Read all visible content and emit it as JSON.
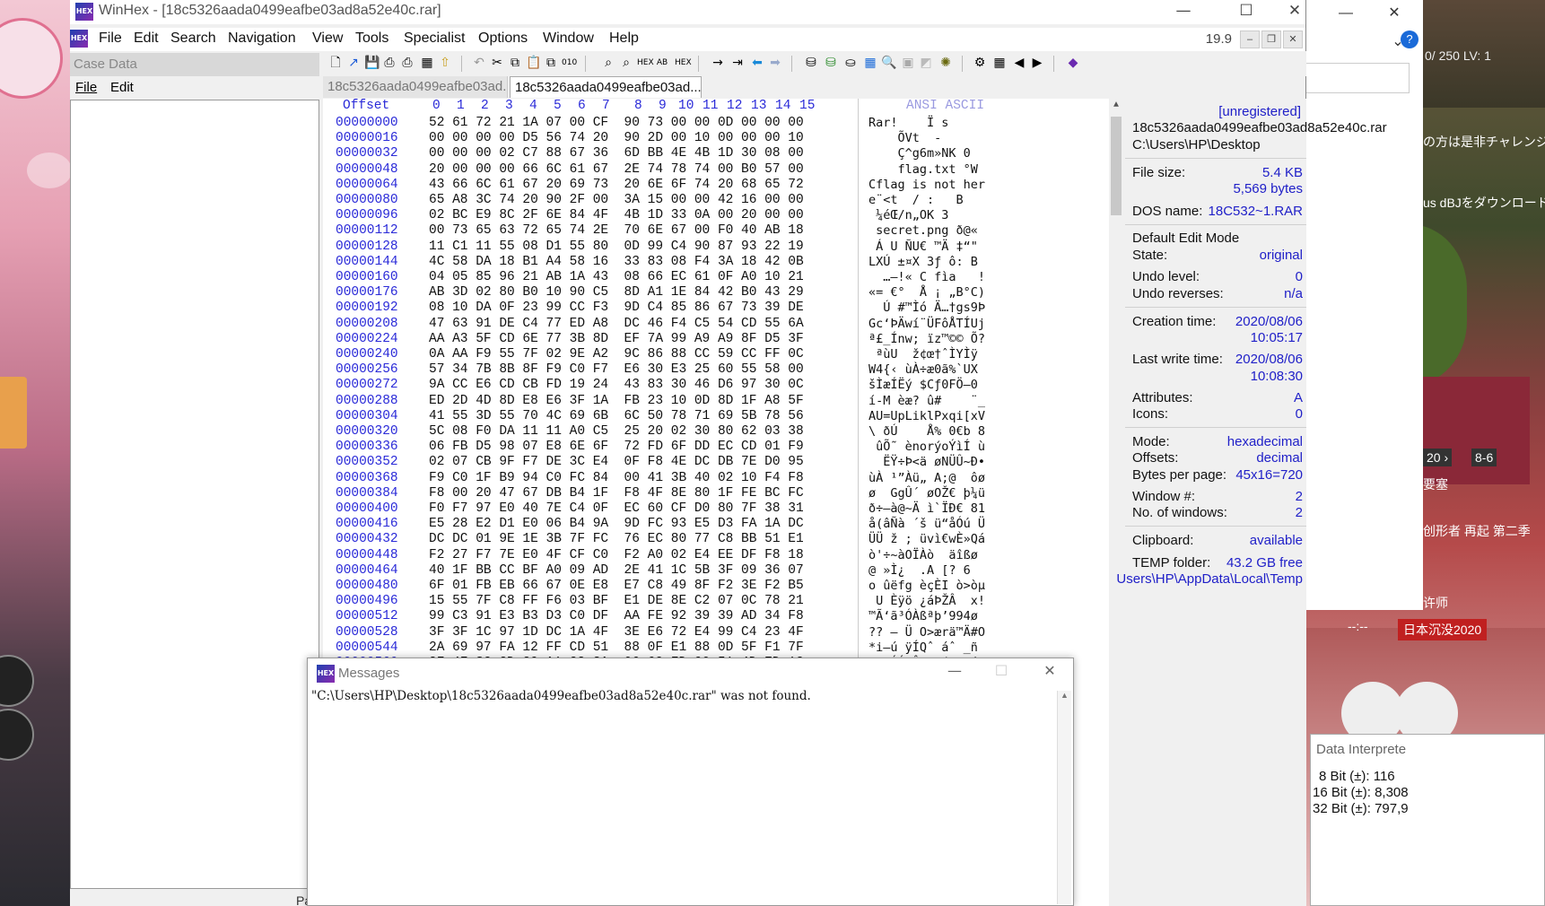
{
  "main_title": "WinHex - [18c5326aada0499eafbe03ad8a52e40c.rar]",
  "menu": [
    "File",
    "Edit",
    "Search",
    "Navigation",
    "View",
    "Tools",
    "Specialist",
    "Options",
    "Window",
    "Help"
  ],
  "version": "19.9",
  "case_panel": {
    "header": "Case Data",
    "menu_file": "File",
    "menu_edit": "Edit"
  },
  "tabs": [
    "18c5326aada0499eafbe03ad...",
    "18c5326aada0499eafbe03ad..."
  ],
  "hex_header": {
    "offset": "Offset",
    "cols": [
      "0",
      "1",
      "2",
      "3",
      "4",
      "5",
      "6",
      "7",
      "8",
      "9",
      "10",
      "11",
      "12",
      "13",
      "14",
      "15"
    ],
    "ansi": "ANSI ASCII"
  },
  "hex_rows": [
    {
      "off": "00000000",
      "bytes": "52 61 72 21 1A 07 00 CF  90 73 00 00 0D 00 00 00",
      "ascii": "Rar!    Ï s"
    },
    {
      "off": "00000016",
      "bytes": "00 00 00 00 D5 56 74 20  90 2D 00 10 00 00 00 10",
      "ascii": "    ÕVt  -"
    },
    {
      "off": "00000032",
      "bytes": "00 00 00 02 C7 88 67 36  6D BB 4E 4B 1D 30 08 00",
      "ascii": "    Ç^g6m»NK 0"
    },
    {
      "off": "00000048",
      "bytes": "20 00 00 00 66 6C 61 67  2E 74 78 74 00 B0 57 00",
      "ascii": "    flag.txt °W"
    },
    {
      "off": "00000064",
      "bytes": "43 66 6C 61 67 20 69 73  20 6E 6F 74 20 68 65 72",
      "ascii": "Cflag is not her"
    },
    {
      "off": "00000080",
      "bytes": "65 A8 3C 74 20 90 2F 00  3A 15 00 00 42 16 00 00",
      "ascii": "e¨<t  / :   B"
    },
    {
      "off": "00000096",
      "bytes": "02 BC E9 8C 2F 6E 84 4F  4B 1D 33 0A 00 20 00 00",
      "ascii": " ¼éŒ/n„OK 3"
    },
    {
      "off": "00000112",
      "bytes": "00 73 65 63 72 65 74 2E  70 6E 67 00 F0 40 AB 18",
      "ascii": " secret.png ð@«"
    },
    {
      "off": "00000128",
      "bytes": "11 C1 11 55 08 D1 55 80  0D 99 C4 90 87 93 22 19",
      "ascii": " Á U ÑU€ ™Ä ‡“\""
    },
    {
      "off": "00000144",
      "bytes": "4C 58 DA 18 B1 A4 58 16  33 83 08 F4 3A 18 42 0B",
      "ascii": "LXÚ ±¤X 3ƒ ô: B"
    },
    {
      "off": "00000160",
      "bytes": "04 05 85 96 21 AB 1A 43  08 66 EC 61 0F A0 10 21",
      "ascii": "  …–!« C fìa   !"
    },
    {
      "off": "00000176",
      "bytes": "AB 3D 02 80 B0 10 90 C5  8D A1 1E 84 42 B0 43 29",
      "ascii": "«= €°  Å ¡ „B°C)"
    },
    {
      "off": "00000192",
      "bytes": "08 10 DA 0F 23 99 CC F3  9D C4 85 86 67 73 39 DE",
      "ascii": "  Ú #™Ìó Ä…†gs9Þ"
    },
    {
      "off": "00000208",
      "bytes": "47 63 91 DE C4 77 ED A8  DC 46 F4 C5 54 CD 55 6A",
      "ascii": "Gc‘ÞÄwí¨ÜFôÅTÍUj"
    },
    {
      "off": "00000224",
      "bytes": "AA A3 5F CD 6E 77 3B 8D  EF 7A 99 A9 A9 8F D5 3F",
      "ascii": "ª£_Ínw; ïz™©© Õ?"
    },
    {
      "off": "00000240",
      "bytes": "0A AA F9 55 7F 02 9E A2  9C 86 88 CC 59 CC FF 0C",
      "ascii": " ªùU  ž¢œ†ˆÌYÌÿ"
    },
    {
      "off": "00000256",
      "bytes": "57 34 7B 8B 8F F9 C0 F7  E6 30 E3 25 60 55 58 00",
      "ascii": "W4{‹ ùÀ÷æ0ã%`UX"
    },
    {
      "off": "00000272",
      "bytes": "9A CC E6 CD CB FD 19 24  43 83 30 46 D6 97 30 0C",
      "ascii": "šÌæÍËý $Cƒ0FÖ—0"
    },
    {
      "off": "00000288",
      "bytes": "ED 2D 4D 8D E8 E6 3F 1A  FB 23 10 0D 8D 1F A8 5F",
      "ascii": "í-M èæ? û#    ¨_"
    },
    {
      "off": "00000304",
      "bytes": "41 55 3D 55 70 4C 69 6B  6C 50 78 71 69 5B 78 56",
      "ascii": "AU=UpLiklPxqi[xV"
    },
    {
      "off": "00000320",
      "bytes": "5C 08 F0 DA 11 11 A0 C5  25 20 02 30 80 62 03 38",
      "ascii": "\\ ðÚ    Å% 0€b 8"
    },
    {
      "off": "00000336",
      "bytes": "06 FB D5 98 07 E8 6E 6F  72 FD 6F DD EC CD 01 F9",
      "ascii": " ûÕ˜ ènorýoÝìÍ ù"
    },
    {
      "off": "00000352",
      "bytes": "02 07 CB 9F F7 DE 3C E4  0F F8 4E DC DB 7E D0 95",
      "ascii": "  ËŸ÷Þ<ä øNÜÛ~Ð•"
    },
    {
      "off": "00000368",
      "bytes": "F9 C0 1F B9 94 C0 FC 84  00 41 3B 40 02 10 F4 F8",
      "ascii": "ùÀ ¹”Àü„ A;@  ôø"
    },
    {
      "off": "00000384",
      "bytes": "F8 00 20 47 67 DB B4 1F  F8 4F 8E 80 1F FE BC FC",
      "ascii": "ø  GgÛ´ øOŽ€ þ¼ü"
    },
    {
      "off": "00000400",
      "bytes": "F0 F7 97 E0 40 7E C4 0F  EC 60 CF D0 80 7F 38 31",
      "ascii": "ð÷—à@~Ä ì`ÏÐ€ 81"
    },
    {
      "off": "00000416",
      "bytes": "E5 28 E2 D1 E0 06 B4 9A  9D FC 93 E5 D3 FA 1A DC",
      "ascii": "å(âÑà ´š ü“åÓú Ü"
    },
    {
      "off": "00000432",
      "bytes": "DC DC 01 9E 1E 3B 7F FC  76 EC 80 77 C8 BB 51 E1",
      "ascii": "ÜÜ ž ; üvì€wÈ»Qá"
    },
    {
      "off": "00000448",
      "bytes": "F2 27 F7 7E E0 4F CF C0  F2 A0 02 E4 EE DF F8 18",
      "ascii": "ò'÷~àOÏÀò  äîßø"
    },
    {
      "off": "00000464",
      "bytes": "40 1F BB CC BF A0 09 AD  2E 41 1C 5B 3F 09 36 07",
      "ascii": "@ »Ì¿  .A [? 6"
    },
    {
      "off": "00000480",
      "bytes": "6F 01 FB EB 66 67 0E E8  E7 C8 49 8F F2 3E F2 B5",
      "ascii": "o ûëfg èçÈI ò>òµ"
    },
    {
      "off": "00000496",
      "bytes": "15 55 7F C8 FF F6 03 BF  E1 DE 8E C2 07 0C 78 21",
      "ascii": " U Èÿö ¿áÞŽÂ  x!"
    },
    {
      "off": "00000512",
      "bytes": "99 C3 91 E3 B3 D3 C0 DF  AA FE 92 39 39 AD 34 F8",
      "ascii": "™Ã‘ã³ÓÀßªþ’99­4ø"
    },
    {
      "off": "00000528",
      "bytes": "3F 3F 1C 97 1D DC 1A 4F  3E E6 72 E4 99 C4 23 4F",
      "ascii": "?? — Ü O>ærä™Ä#O"
    },
    {
      "off": "00000544",
      "bytes": "2A 69 97 FA 12 FF CD 51  88 0F E1 88 0D 5F F1 7F",
      "ascii": "*i—ú ÿÍQˆ áˆ _ñ"
    },
    {
      "off": "00000560",
      "bytes": "2F 4F 8C CD C9 A1 C2 3A  06 69 FD 90 51 4D ED 1C",
      "ascii": "/OŒÍÉ¡Â: iý QMí"
    }
  ],
  "info": {
    "unregistered": "[unregistered]",
    "filename": "18c5326aada0499eafbe03ad8a52e40c.rar",
    "path": "C:\\Users\\HP\\Desktop",
    "file_size_label": "File size:",
    "file_size_kb": "5.4 KB",
    "file_size_bytes": "5,569 bytes",
    "dos_name_label": "DOS name:",
    "dos_name": "18C532~1.RAR",
    "edit_mode_label": "Default Edit Mode",
    "state_label": "State:",
    "state": "original",
    "undo_level_label": "Undo level:",
    "undo_level": "0",
    "undo_rev_label": "Undo reverses:",
    "undo_rev": "n/a",
    "creation_label": "Creation time:",
    "creation_date": "2020/08/06",
    "creation_time": "10:05:17",
    "lastwrite_label": "Last write time:",
    "lastwrite_date": "2020/08/06",
    "lastwrite_time": "10:08:30",
    "attributes_label": "Attributes:",
    "attributes": "A",
    "icons_label": "Icons:",
    "icons": "0",
    "mode_label": "Mode:",
    "mode": "hexadecimal",
    "offsets_label": "Offsets:",
    "offsets": "decimal",
    "bpp_label": "Bytes per page:",
    "bpp": "45x16=720",
    "window_label": "Window #:",
    "window": "2",
    "nwindows_label": "No. of windows:",
    "nwindows": "2",
    "clipboard_label": "Clipboard:",
    "clipboard": "available",
    "temp_label": "TEMP folder:",
    "temp_free": "43.2 GB free",
    "temp_path": "Users\\HP\\AppData\\Local\\Temp"
  },
  "messages": {
    "title": "Messages",
    "text": "\"C:\\Users\\HP\\Desktop\\18c5326aada0499eafbe03ad8a52e40c.rar\" was not found."
  },
  "status": {
    "page": "Page 1 of 8"
  },
  "data_interpreter": {
    "title": "Data Interprete",
    "bit8": "8 Bit (±): 116",
    "bit16": "16 Bit (±): 8,308",
    "bit32": "32 Bit (±): 797,9"
  },
  "bg_window": {
    "addr": "a52e40c\""
  },
  "bg_texts": {
    "jp1": "の方は是非チャレンジ",
    "jp2": "us dBJをダウンロード中",
    "jp3": "要塞",
    "jp4": "创形者 再起 第二季",
    "jp5": "许师",
    "jp6": "日本沉没2020",
    "time": "--:--",
    "hud": "0/ 250  LV: 1",
    "nav1": "20 ›",
    "nav2": "8-6"
  },
  "colors": {
    "accent_blue": "#2020c8",
    "offset_blue": "#2a2ad8"
  }
}
